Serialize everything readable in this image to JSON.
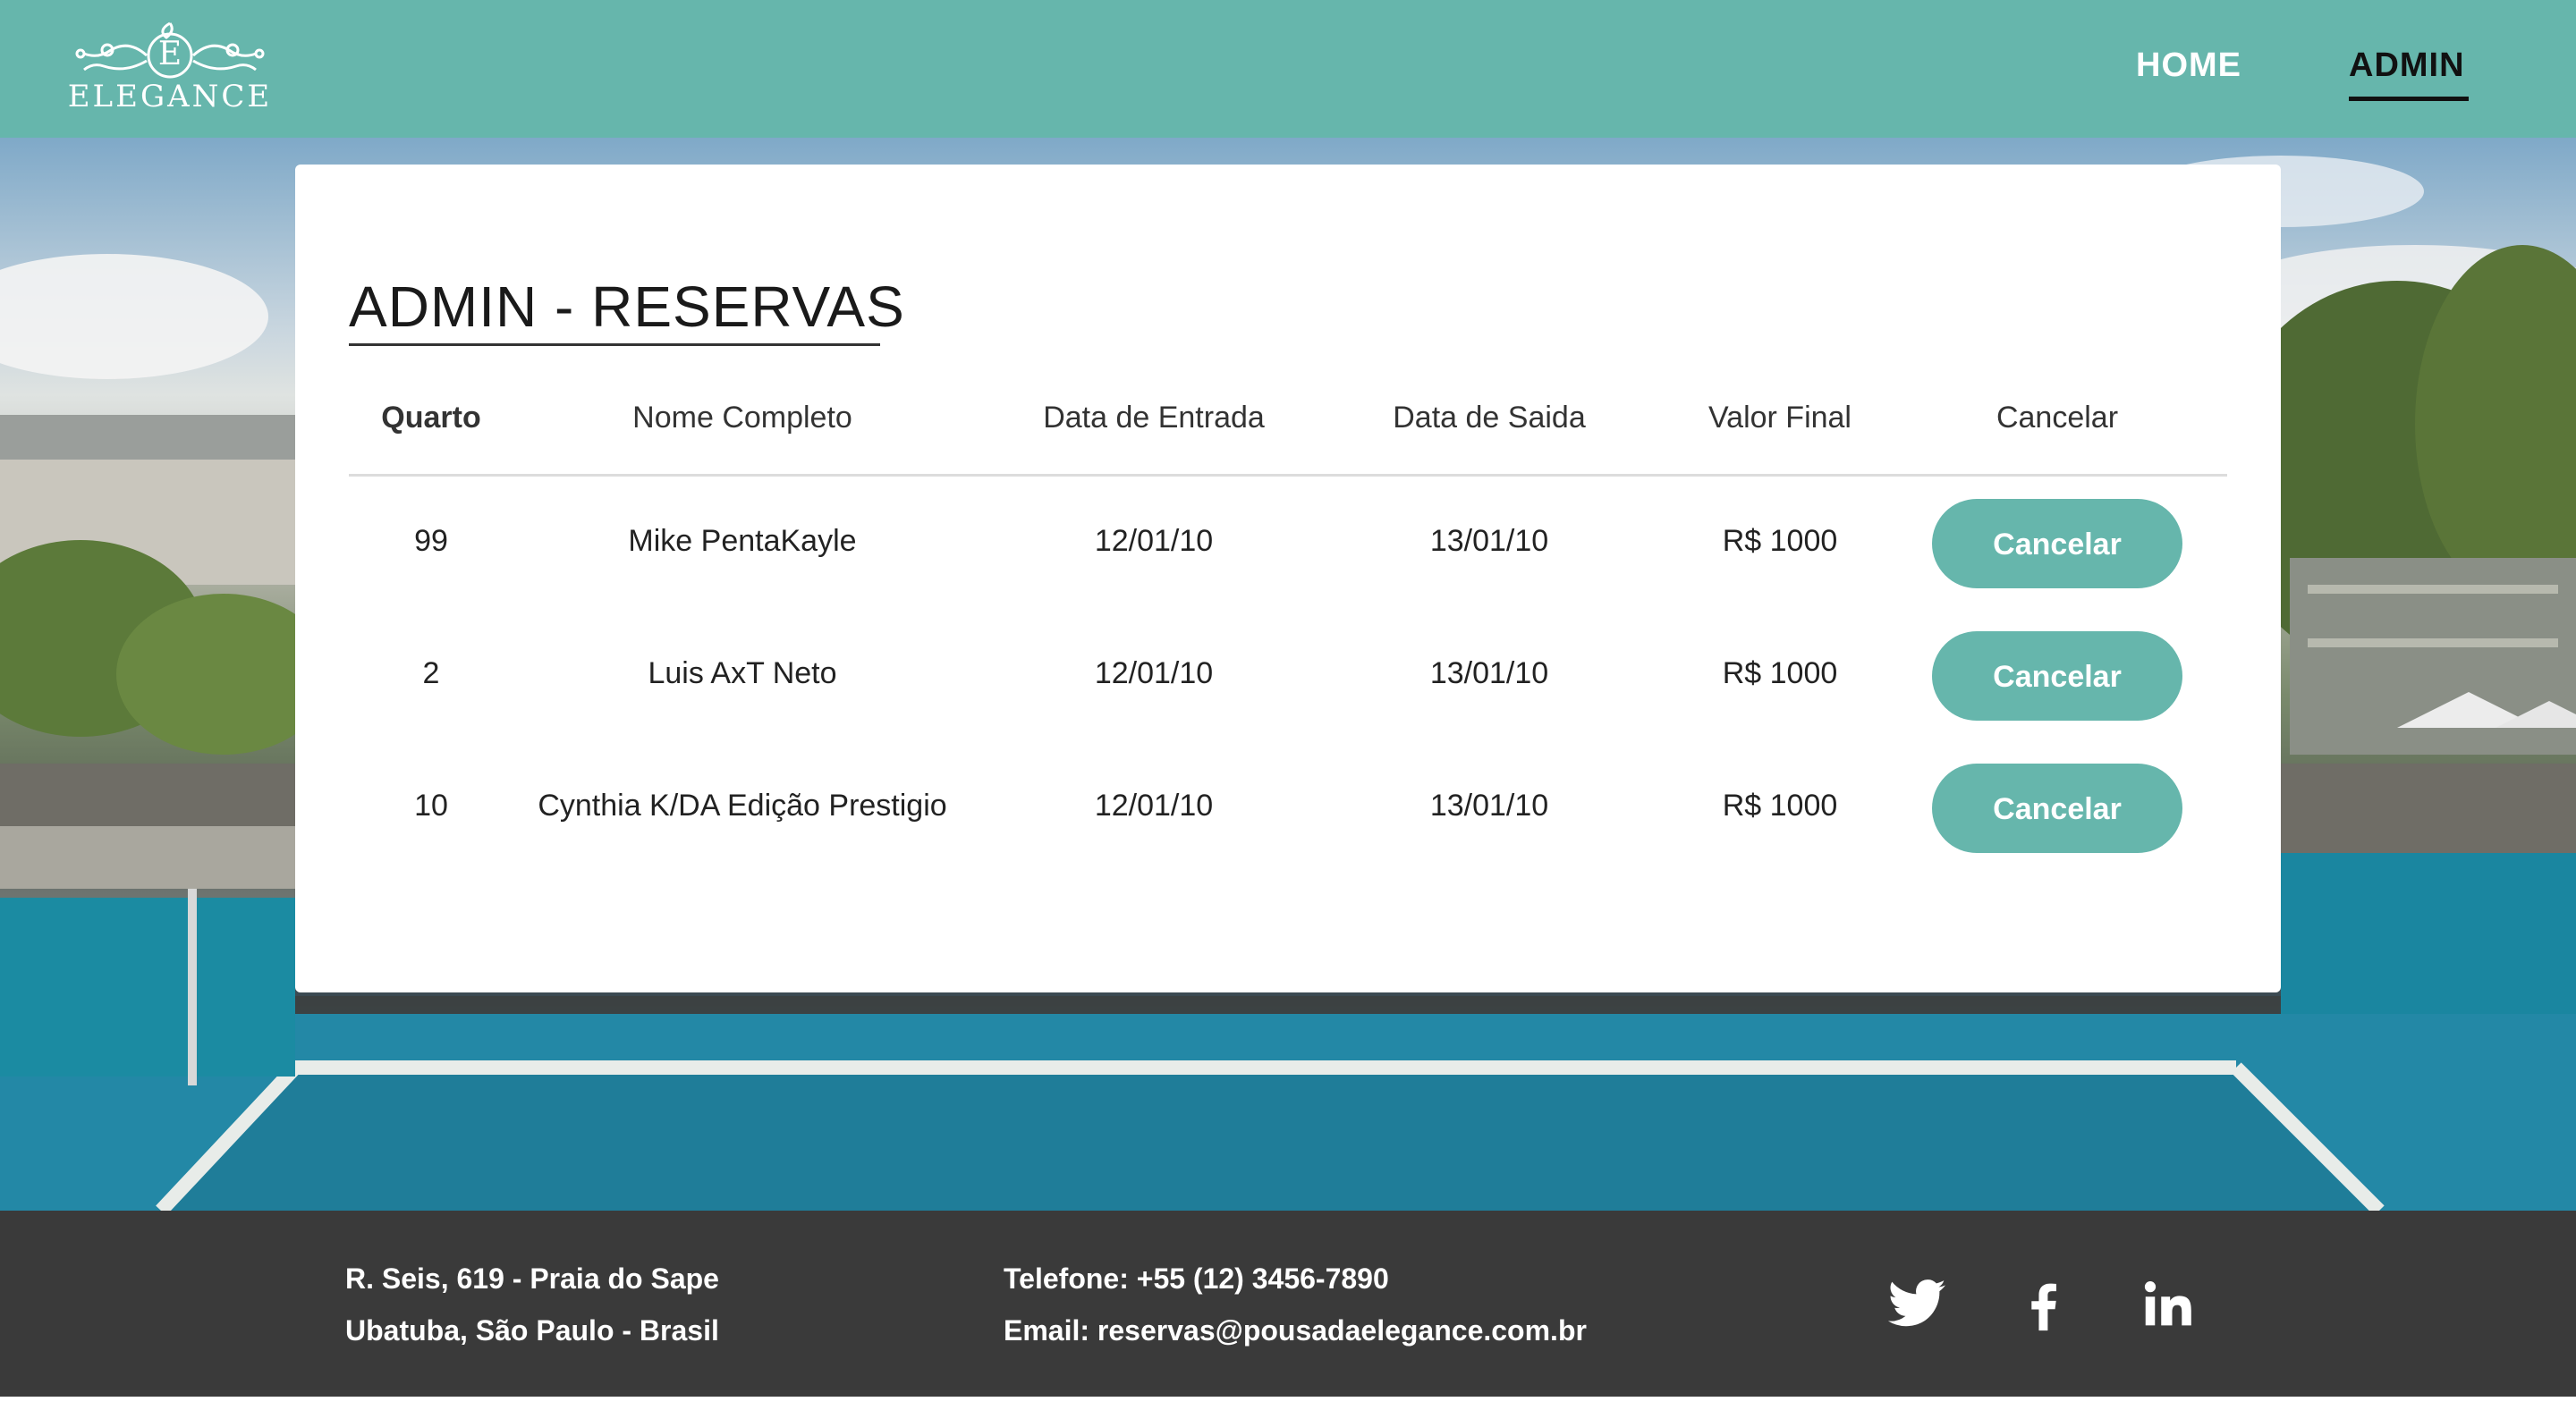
{
  "header": {
    "logo_letter": "E",
    "logo_text": "ELEGANCE",
    "nav": [
      {
        "label": "HOME",
        "active": false
      },
      {
        "label": "ADMIN",
        "active": true
      }
    ]
  },
  "page": {
    "title": "ADMIN - RESERVAS"
  },
  "table": {
    "columns": [
      "Quarto",
      "Nome Completo",
      "Data de Entrada",
      "Data de Saida",
      "Valor Final",
      "Cancelar"
    ],
    "rows": [
      {
        "quarto": "99",
        "nome": "Mike PentaKayle",
        "entrada": "12/01/10",
        "saida": "13/01/10",
        "valor": "R$ 1000",
        "action": "Cancelar"
      },
      {
        "quarto": "2",
        "nome": "Luis AxT Neto",
        "entrada": "12/01/10",
        "saida": "13/01/10",
        "valor": "R$ 1000",
        "action": "Cancelar"
      },
      {
        "quarto": "10",
        "nome": "Cynthia K/DA Edição Prestigio",
        "entrada": "12/01/10",
        "saida": "13/01/10",
        "valor": "R$ 1000",
        "action": "Cancelar"
      }
    ]
  },
  "footer": {
    "address_line1": "R. Seis, 619 - Praia do Sape",
    "address_line2": "Ubatuba, São Paulo - Brasil",
    "phone": "Telefone: +55 (12) 3456-7890",
    "email": "Email: reservas@pousadaelegance.com.br",
    "social": [
      "twitter-icon",
      "facebook-icon",
      "linkedin-icon"
    ]
  },
  "colors": {
    "brand": "#66b6ac",
    "footer": "#3a3a3a",
    "active_nav": "#111111"
  }
}
